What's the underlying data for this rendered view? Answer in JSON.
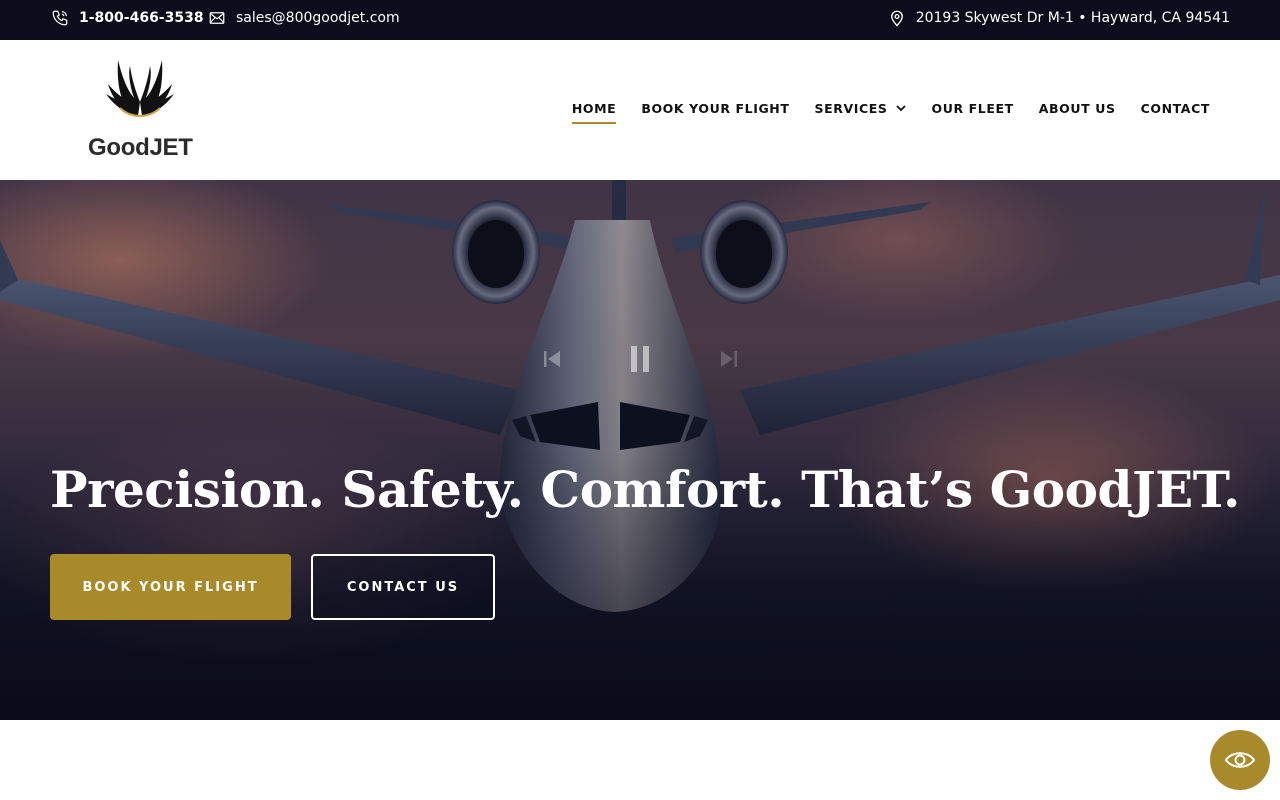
{
  "topbar": {
    "phone": "1-800-466-3538",
    "email": "sales@800goodjet.com",
    "address": "20193 Skywest Dr M-1 • Hayward, CA 94541"
  },
  "logo": {
    "text": "GoodJET"
  },
  "nav": {
    "items": [
      {
        "label": "HOME",
        "active": true
      },
      {
        "label": "BOOK YOUR FLIGHT"
      },
      {
        "label": "SERVICES",
        "has_dropdown": true
      },
      {
        "label": "OUR FLEET"
      },
      {
        "label": "ABOUT US"
      },
      {
        "label": "CONTACT"
      }
    ]
  },
  "hero": {
    "headline": "Precision. Safety. Comfort. That’s GoodJET.",
    "book_button": "BOOK YOUR FLIGHT",
    "contact_button": "CONTACT US",
    "slider_controls": [
      "previous-icon",
      "pause-icon",
      "next-icon"
    ]
  },
  "colors": {
    "accent": "#a98a2a",
    "topbar_bg": "#0b0d1b",
    "nav_text": "#111111"
  },
  "icons": [
    "phone-icon",
    "mail-icon",
    "location-pin-icon",
    "chevron-down-icon",
    "eye-icon"
  ]
}
